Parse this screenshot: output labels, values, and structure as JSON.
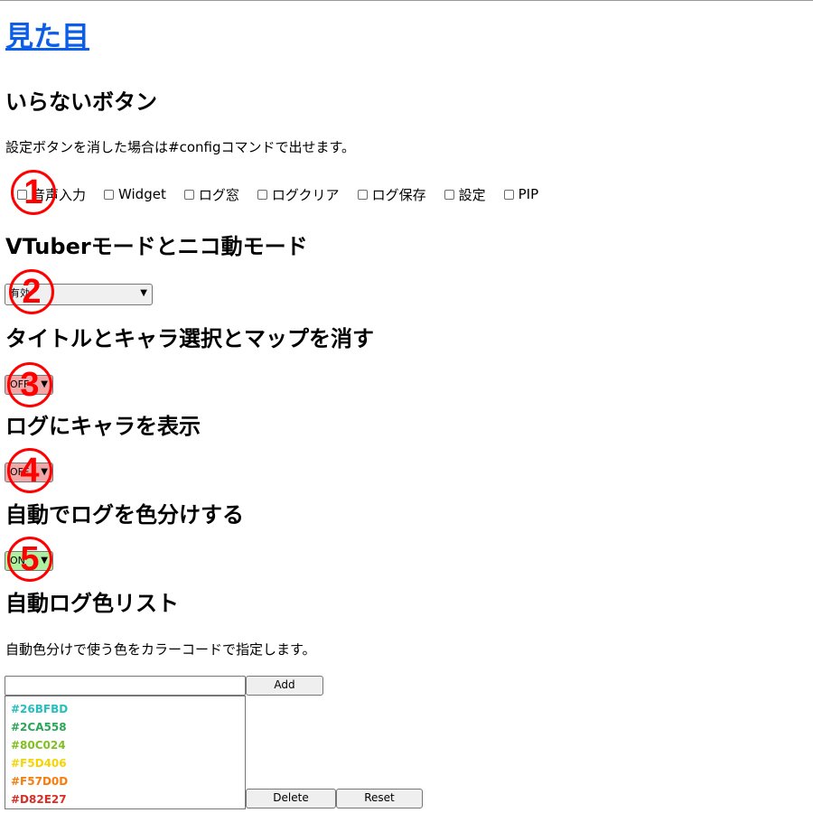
{
  "page": {
    "heading": "見た目"
  },
  "sections": {
    "buttons": {
      "title": "いらないボタン",
      "description": "設定ボタンを消した場合は#configコマンドで出せます。",
      "checkboxes": [
        {
          "label": "音声入力",
          "checked": false
        },
        {
          "label": "Widget",
          "checked": false
        },
        {
          "label": "ログ窓",
          "checked": false
        },
        {
          "label": "ログクリア",
          "checked": false
        },
        {
          "label": "ログ保存",
          "checked": false
        },
        {
          "label": "設定",
          "checked": false
        },
        {
          "label": "PIP",
          "checked": false
        }
      ]
    },
    "mode": {
      "title": "VTuberモードとニコ動モード",
      "selected": "有効"
    },
    "hide_title": {
      "title": "タイトルとキャラ選択とマップを消す",
      "selected": "OFF"
    },
    "log_chara": {
      "title": "ログにキャラを表示",
      "selected": "OFF"
    },
    "auto_color": {
      "title": "自動でログを色分けする",
      "selected": "ON"
    },
    "color_list": {
      "title": "自動ログ色リスト",
      "description": "自動色分けで使う色をカラーコードで指定します。",
      "input_value": "",
      "add_label": "Add",
      "delete_label": "Delete",
      "reset_label": "Reset",
      "items": [
        "#26BFBD",
        "#2CA558",
        "#80C024",
        "#F5D406",
        "#F57D0D",
        "#D82E27"
      ],
      "item_colors": [
        "#26BFBD",
        "#2CA558",
        "#80C024",
        "#F5D406",
        "#F57D0D",
        "#D82E27"
      ]
    }
  },
  "annotations": [
    "1",
    "2",
    "3",
    "4",
    "5"
  ],
  "colors": {
    "link": "#0d5ee6",
    "off_bg": "#f2a7a7",
    "on_bg": "#aef0a0",
    "annotation": "#ff0000"
  }
}
